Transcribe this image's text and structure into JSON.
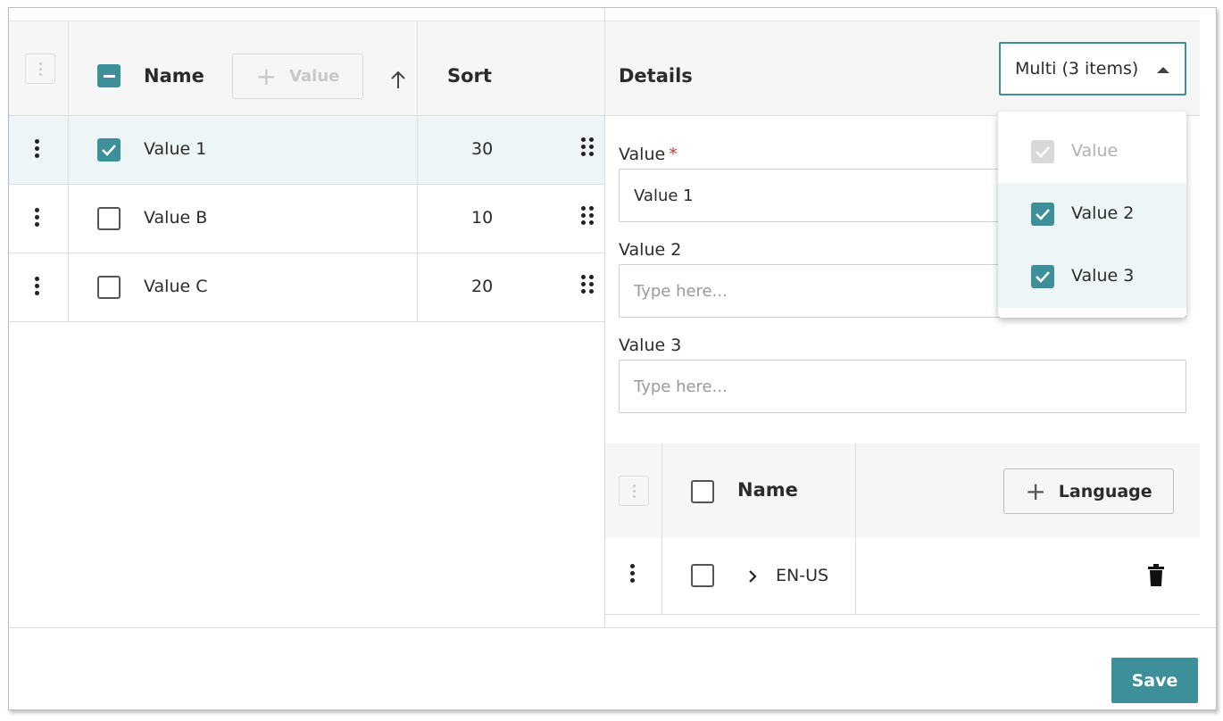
{
  "grid": {
    "header": {
      "name_label": "Name",
      "add_value_label": "Value",
      "sort_label": "Sort"
    },
    "rows": [
      {
        "name": "Value 1",
        "sort": "30",
        "selected": true
      },
      {
        "name": "Value B",
        "sort": "10",
        "selected": false
      },
      {
        "name": "Value C",
        "sort": "20",
        "selected": false
      }
    ]
  },
  "details": {
    "title": "Details",
    "selector_value": "Multi (3 items)",
    "dropdown_options": [
      {
        "label": "Value",
        "checked": true,
        "disabled": true
      },
      {
        "label": "Value 2",
        "checked": true,
        "disabled": false
      },
      {
        "label": "Value 3",
        "checked": true,
        "disabled": false
      }
    ],
    "fields": [
      {
        "label": "Value",
        "required_mark": "*",
        "value": "Value 1",
        "placeholder": ""
      },
      {
        "label": "Value 2",
        "value": "",
        "placeholder": "Type here..."
      },
      {
        "label": "Value 3",
        "value": "",
        "placeholder": "Type here..."
      }
    ],
    "subgrid": {
      "name_label": "Name",
      "add_language_label": "Language",
      "rows": [
        {
          "code": "EN-US"
        }
      ]
    }
  },
  "footer": {
    "save_label": "Save"
  },
  "colors": {
    "accent": "#3d8f9a",
    "selected_row": "#edf5f6",
    "required": "#c0392b"
  }
}
